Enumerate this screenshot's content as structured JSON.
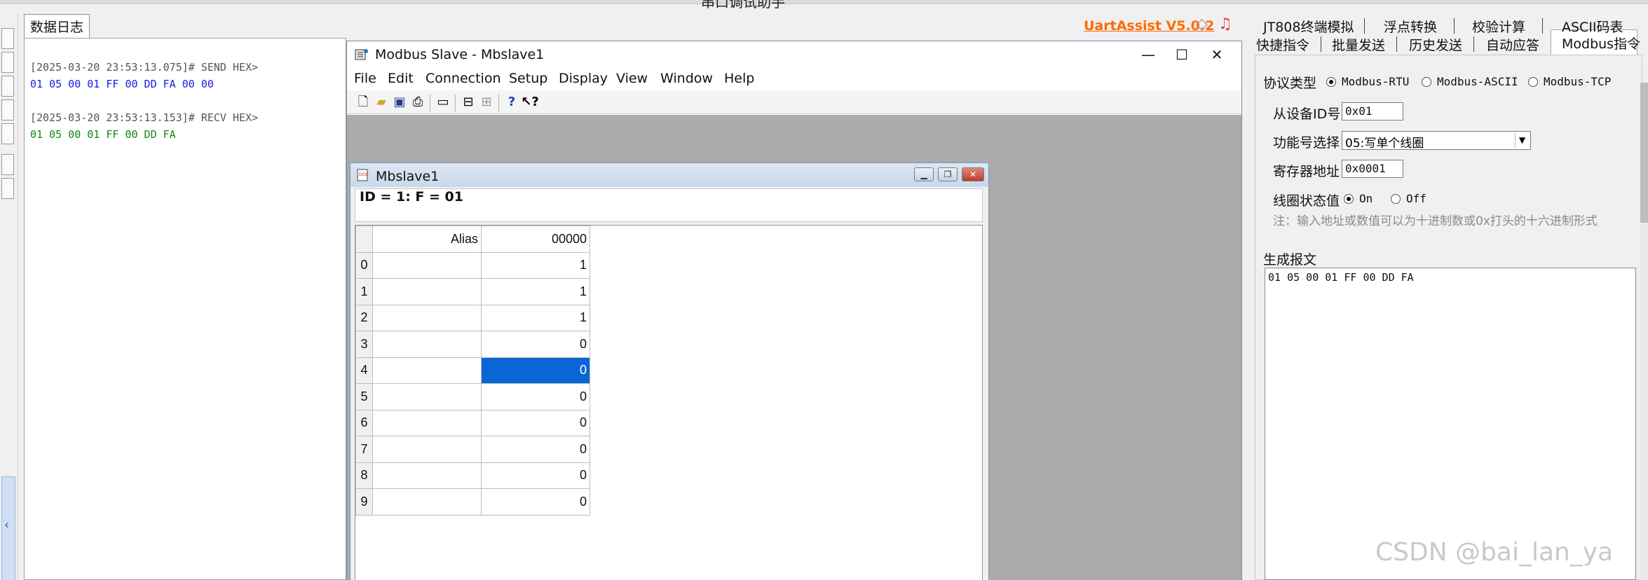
{
  "topbar": {
    "title": "串口调试助手"
  },
  "log": {
    "tab_label": "数据日志",
    "lines": [
      {
        "text": "[2025-03-20 23:53:13.075]# SEND HEX>",
        "color": "#555555"
      },
      {
        "text": "01 05 00 01 FF 00 DD FA 00 00",
        "color": "#1a1ae6"
      },
      {
        "text": "[2025-03-20 23:53:13.153]# RECV HEX>",
        "color": "#555555"
      },
      {
        "text": "01 05 00 01 FF 00 DD FA",
        "color": "#118811"
      }
    ]
  },
  "header": {
    "brand": "UartAssist V5.0.2",
    "icons": [
      "gem-icon",
      "bell-icon"
    ]
  },
  "right_panel": {
    "tabs_row1": [
      "JT808终端模拟",
      "浮点转换",
      "校验计算",
      "ASCII码表"
    ],
    "tabs_row2": [
      "快捷指令",
      "批量发送",
      "历史发送",
      "自动应答",
      "Modbus指令"
    ],
    "active_tab": "Modbus指令",
    "protocol_label": "协议类型",
    "protocol_options": [
      "Modbus-RTU",
      "Modbus-ASCII",
      "Modbus-TCP"
    ],
    "protocol_selected": "Modbus-RTU",
    "slave_id_label": "从设备ID号",
    "slave_id_value": "0x01",
    "func_label": "功能号选择",
    "func_value": "05:写单个线圈",
    "reg_label": "寄存器地址",
    "reg_value": "0x0001",
    "coil_label": "线圈状态值",
    "coil_options": [
      "On",
      "Off"
    ],
    "coil_selected": "On",
    "note": "注：输入地址或数值可以为十进制数或0x打头的十六进制形式",
    "gen_label": "生成报文",
    "gen_text": "01 05 00 01 FF 00 DD FA"
  },
  "modbus_slave": {
    "title": "Modbus Slave - Mbslave1",
    "menus": [
      "File",
      "Edit",
      "Connection",
      "Setup",
      "Display",
      "View",
      "Window",
      "Help"
    ],
    "child": {
      "title": "Mbslave1",
      "info": "ID = 1: F = 01",
      "col_alias": "Alias",
      "col_addr": "00000",
      "rows": [
        {
          "n": "0",
          "v": "1"
        },
        {
          "n": "1",
          "v": "1"
        },
        {
          "n": "2",
          "v": "1"
        },
        {
          "n": "3",
          "v": "0"
        },
        {
          "n": "4",
          "v": "0"
        },
        {
          "n": "5",
          "v": "0"
        },
        {
          "n": "6",
          "v": "0"
        },
        {
          "n": "7",
          "v": "0"
        },
        {
          "n": "8",
          "v": "0"
        },
        {
          "n": "9",
          "v": "0"
        }
      ],
      "selected_row": "4"
    }
  },
  "watermark": "CSDN @bai_lan_ya"
}
